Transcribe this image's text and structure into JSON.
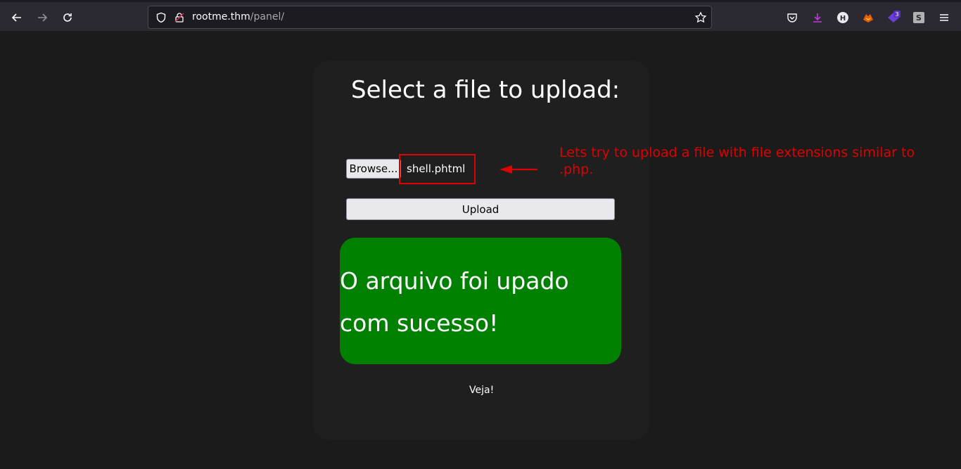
{
  "browser": {
    "url_host": "rootme.thm",
    "url_path": "/panel/",
    "extension_badge": "3",
    "colors": {
      "toolbar": "#2b2a33",
      "urlbar": "#1c1b22"
    }
  },
  "page": {
    "title": "Select a file to upload:",
    "file_input": {
      "browse_label": "Browse...",
      "selected_file": "shell.phtml"
    },
    "upload_label": "Upload",
    "success_message": "O arquivo foi upado com sucesso!",
    "footer_link": "Veja!",
    "colors": {
      "success": "#008000",
      "annotation": "#e00000",
      "background": "#1b1b1b"
    }
  },
  "annotation": {
    "text": "Lets try to upload a file with file extensions similar to .php."
  }
}
